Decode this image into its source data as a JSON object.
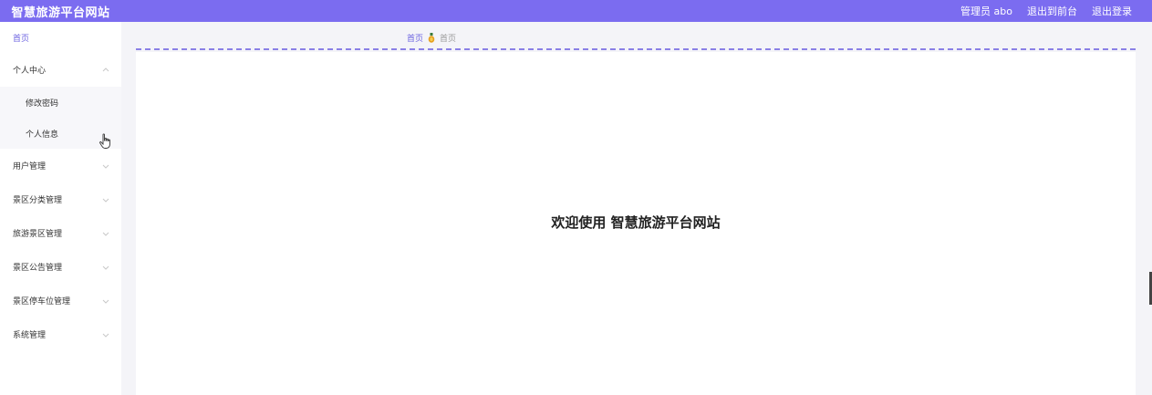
{
  "app": {
    "title": "智慧旅游平台网站"
  },
  "header": {
    "user_label": "管理员 abo",
    "to_frontend": "退出到前台",
    "logout": "退出登录"
  },
  "sidebar": {
    "home": "首页",
    "groups": [
      {
        "label": "个人中心",
        "expanded": true,
        "children": [
          "修改密码",
          "个人信息"
        ]
      },
      {
        "label": "用户管理",
        "expanded": false
      },
      {
        "label": "景区分类管理",
        "expanded": false
      },
      {
        "label": "旅游景区管理",
        "expanded": false
      },
      {
        "label": "景区公告管理",
        "expanded": false
      },
      {
        "label": "景区停车位管理",
        "expanded": false
      },
      {
        "label": "系统管理",
        "expanded": false
      }
    ]
  },
  "breadcrumb": {
    "home": "首页",
    "current": "首页"
  },
  "main": {
    "welcome": "欢迎使用 智慧旅游平台网站"
  },
  "colors": {
    "accent": "#7b6cf0",
    "link": "#6c63e0"
  },
  "icons": {
    "chevron": "chevron-icon",
    "breadcrumb_separator": "medal-icon",
    "cursor": "hand-cursor-icon"
  }
}
